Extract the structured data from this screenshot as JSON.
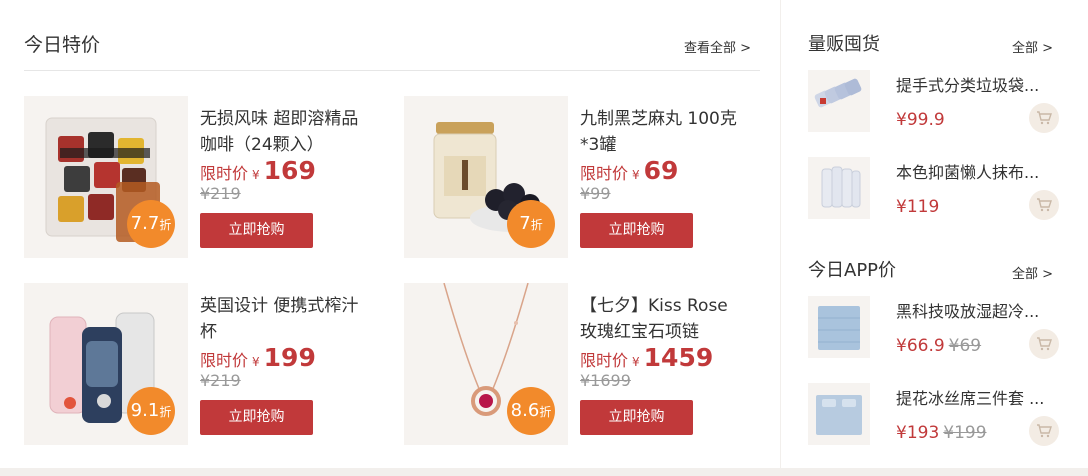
{
  "left": {
    "title": "今日特价",
    "more": "查看全部 >",
    "cards": [
      {
        "name": "无损风味 超即溶精品咖啡（24颗入）",
        "price_label": "限时价",
        "currency": "¥",
        "price": "169",
        "old_price": "¥219",
        "discount": "7.7",
        "discount_unit": "折",
        "buy_label": "立即抢购",
        "icon": "coffee-pods-image"
      },
      {
        "name": "九制黑芝麻丸 100克*3罐",
        "price_label": "限时价",
        "currency": "¥",
        "price": "69",
        "old_price": "¥99",
        "discount": "7",
        "discount_unit": "折",
        "buy_label": "立即抢购",
        "icon": "sesame-balls-jar-image"
      },
      {
        "name": "英国设计 便携式榨汁杯",
        "price_label": "限时价",
        "currency": "¥",
        "price": "199",
        "old_price": "¥219",
        "discount": "9.1",
        "discount_unit": "折",
        "buy_label": "立即抢购",
        "icon": "juicer-cups-image"
      },
      {
        "name": "【七夕】Kiss Rose 玫瑰红宝石项链",
        "price_label": "限时价",
        "currency": "¥",
        "price": "1459",
        "old_price": "¥1699",
        "discount": "8.6",
        "discount_unit": "折",
        "buy_label": "立即抢购",
        "icon": "ruby-necklace-image"
      }
    ]
  },
  "bulk": {
    "title": "量贩囤货",
    "more": "全部 >",
    "items": [
      {
        "name": "提手式分类垃圾袋...",
        "price": "¥99.9",
        "old_price": "",
        "icon": "trash-bags-image"
      },
      {
        "name": "本色抑菌懒人抹布...",
        "price": "¥119",
        "old_price": "",
        "icon": "cloth-rolls-image"
      }
    ]
  },
  "app": {
    "title": "今日APP价",
    "more": "全部 >",
    "items": [
      {
        "name": "黑科技吸放湿超冷...",
        "price": "¥66.9",
        "old_price": "¥69",
        "icon": "blue-quilt-image"
      },
      {
        "name": "提花冰丝席三件套 ...",
        "price": "¥193",
        "old_price": "¥199",
        "icon": "ice-silk-mat-image"
      }
    ]
  },
  "colors": {
    "accent": "#c1393a",
    "badge": "#f28a2b",
    "muted": "#999999"
  }
}
